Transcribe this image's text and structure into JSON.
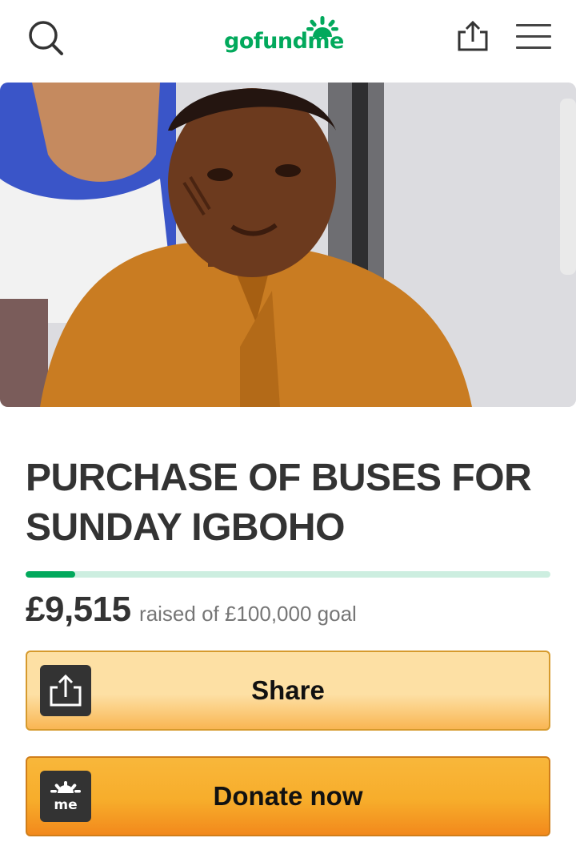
{
  "header": {
    "logo_text": "gofundme",
    "icons": {
      "search": "search-icon",
      "share": "share-icon",
      "menu": "hamburger-menu-icon"
    }
  },
  "hero": {
    "image": "campaign-photo"
  },
  "campaign": {
    "title": "PURCHASE OF BUSES FOR SUNDAY IGBOHO",
    "amount_raised": "£9,515",
    "goal_text": "raised of £100,000 goal",
    "progress_fraction": 0.095
  },
  "buttons": {
    "share_label": "Share",
    "donate_label": "Donate now",
    "share_icon": "upload-share-icon",
    "donate_icon": "gofundme-me-icon"
  },
  "colors": {
    "brand_green": "#02a95c",
    "progress_track": "#cdeee0",
    "share_button": "#fde0a4",
    "donate_button": "#f7ad2b"
  }
}
